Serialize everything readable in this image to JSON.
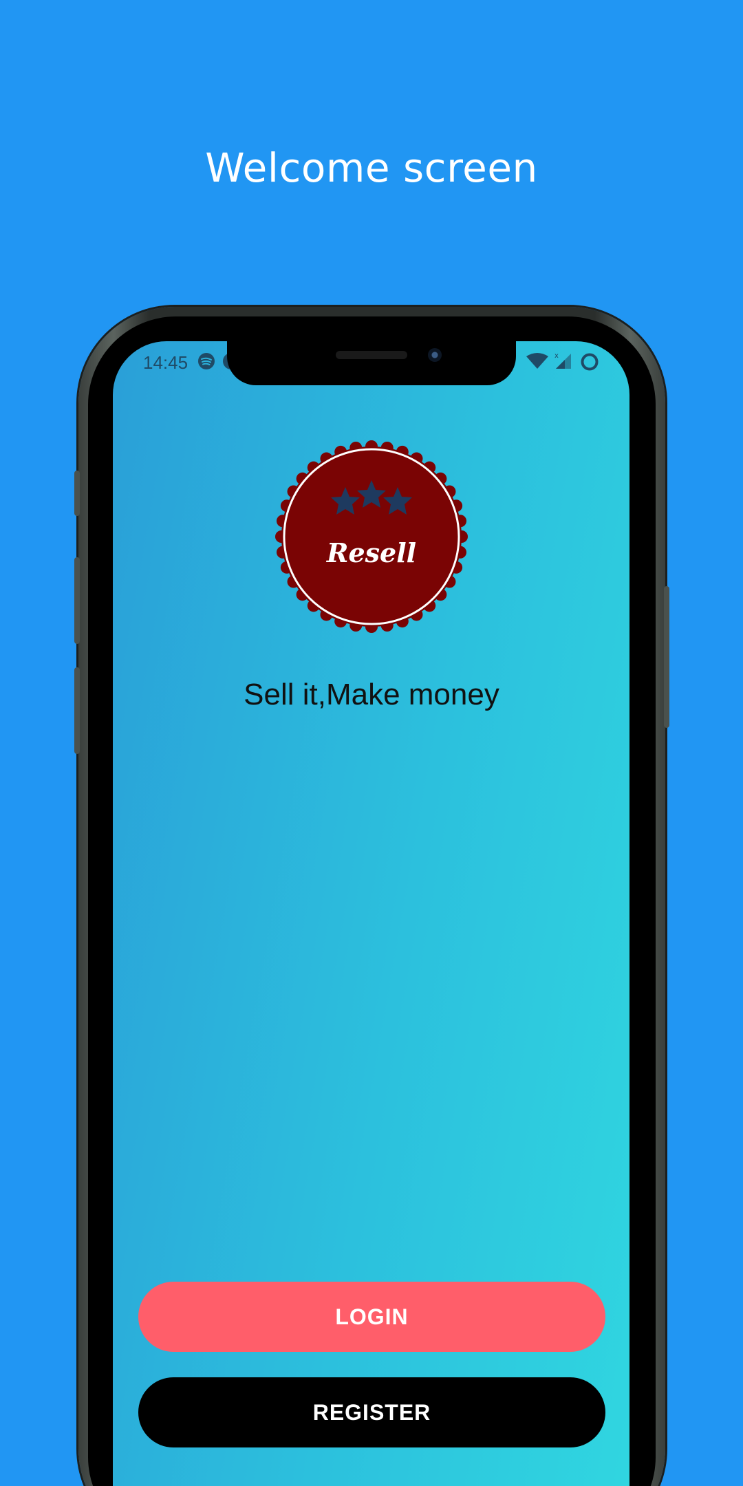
{
  "page": {
    "title": "Welcome screen"
  },
  "status_bar": {
    "time": "14:45"
  },
  "logo": {
    "text": "Resell",
    "colors": {
      "badge": "#7A0404",
      "ring": "#FFFFFF",
      "stars": "#1E3A5F"
    }
  },
  "app": {
    "tagline": "Sell it,Make money",
    "login_label": "LOGIN",
    "register_label": "REGISTER"
  },
  "colors": {
    "background": "#2196F3",
    "login_button": "#FF5E6A",
    "register_button": "#000000"
  }
}
